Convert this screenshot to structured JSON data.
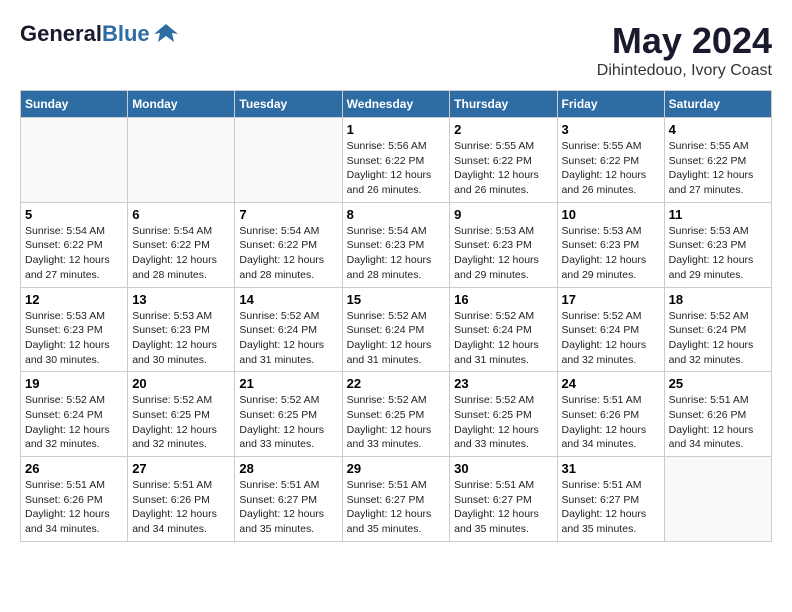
{
  "header": {
    "logo_general": "General",
    "logo_blue": "Blue",
    "month_year": "May 2024",
    "location": "Dihintedouo, Ivory Coast"
  },
  "weekdays": [
    "Sunday",
    "Monday",
    "Tuesday",
    "Wednesday",
    "Thursday",
    "Friday",
    "Saturday"
  ],
  "weeks": [
    [
      {
        "day": "",
        "info": ""
      },
      {
        "day": "",
        "info": ""
      },
      {
        "day": "",
        "info": ""
      },
      {
        "day": "1",
        "info": "Sunrise: 5:56 AM\nSunset: 6:22 PM\nDaylight: 12 hours\nand 26 minutes."
      },
      {
        "day": "2",
        "info": "Sunrise: 5:55 AM\nSunset: 6:22 PM\nDaylight: 12 hours\nand 26 minutes."
      },
      {
        "day": "3",
        "info": "Sunrise: 5:55 AM\nSunset: 6:22 PM\nDaylight: 12 hours\nand 26 minutes."
      },
      {
        "day": "4",
        "info": "Sunrise: 5:55 AM\nSunset: 6:22 PM\nDaylight: 12 hours\nand 27 minutes."
      }
    ],
    [
      {
        "day": "5",
        "info": "Sunrise: 5:54 AM\nSunset: 6:22 PM\nDaylight: 12 hours\nand 27 minutes."
      },
      {
        "day": "6",
        "info": "Sunrise: 5:54 AM\nSunset: 6:22 PM\nDaylight: 12 hours\nand 28 minutes."
      },
      {
        "day": "7",
        "info": "Sunrise: 5:54 AM\nSunset: 6:22 PM\nDaylight: 12 hours\nand 28 minutes."
      },
      {
        "day": "8",
        "info": "Sunrise: 5:54 AM\nSunset: 6:23 PM\nDaylight: 12 hours\nand 28 minutes."
      },
      {
        "day": "9",
        "info": "Sunrise: 5:53 AM\nSunset: 6:23 PM\nDaylight: 12 hours\nand 29 minutes."
      },
      {
        "day": "10",
        "info": "Sunrise: 5:53 AM\nSunset: 6:23 PM\nDaylight: 12 hours\nand 29 minutes."
      },
      {
        "day": "11",
        "info": "Sunrise: 5:53 AM\nSunset: 6:23 PM\nDaylight: 12 hours\nand 29 minutes."
      }
    ],
    [
      {
        "day": "12",
        "info": "Sunrise: 5:53 AM\nSunset: 6:23 PM\nDaylight: 12 hours\nand 30 minutes."
      },
      {
        "day": "13",
        "info": "Sunrise: 5:53 AM\nSunset: 6:23 PM\nDaylight: 12 hours\nand 30 minutes."
      },
      {
        "day": "14",
        "info": "Sunrise: 5:52 AM\nSunset: 6:24 PM\nDaylight: 12 hours\nand 31 minutes."
      },
      {
        "day": "15",
        "info": "Sunrise: 5:52 AM\nSunset: 6:24 PM\nDaylight: 12 hours\nand 31 minutes."
      },
      {
        "day": "16",
        "info": "Sunrise: 5:52 AM\nSunset: 6:24 PM\nDaylight: 12 hours\nand 31 minutes."
      },
      {
        "day": "17",
        "info": "Sunrise: 5:52 AM\nSunset: 6:24 PM\nDaylight: 12 hours\nand 32 minutes."
      },
      {
        "day": "18",
        "info": "Sunrise: 5:52 AM\nSunset: 6:24 PM\nDaylight: 12 hours\nand 32 minutes."
      }
    ],
    [
      {
        "day": "19",
        "info": "Sunrise: 5:52 AM\nSunset: 6:24 PM\nDaylight: 12 hours\nand 32 minutes."
      },
      {
        "day": "20",
        "info": "Sunrise: 5:52 AM\nSunset: 6:25 PM\nDaylight: 12 hours\nand 32 minutes."
      },
      {
        "day": "21",
        "info": "Sunrise: 5:52 AM\nSunset: 6:25 PM\nDaylight: 12 hours\nand 33 minutes."
      },
      {
        "day": "22",
        "info": "Sunrise: 5:52 AM\nSunset: 6:25 PM\nDaylight: 12 hours\nand 33 minutes."
      },
      {
        "day": "23",
        "info": "Sunrise: 5:52 AM\nSunset: 6:25 PM\nDaylight: 12 hours\nand 33 minutes."
      },
      {
        "day": "24",
        "info": "Sunrise: 5:51 AM\nSunset: 6:26 PM\nDaylight: 12 hours\nand 34 minutes."
      },
      {
        "day": "25",
        "info": "Sunrise: 5:51 AM\nSunset: 6:26 PM\nDaylight: 12 hours\nand 34 minutes."
      }
    ],
    [
      {
        "day": "26",
        "info": "Sunrise: 5:51 AM\nSunset: 6:26 PM\nDaylight: 12 hours\nand 34 minutes."
      },
      {
        "day": "27",
        "info": "Sunrise: 5:51 AM\nSunset: 6:26 PM\nDaylight: 12 hours\nand 34 minutes."
      },
      {
        "day": "28",
        "info": "Sunrise: 5:51 AM\nSunset: 6:27 PM\nDaylight: 12 hours\nand 35 minutes."
      },
      {
        "day": "29",
        "info": "Sunrise: 5:51 AM\nSunset: 6:27 PM\nDaylight: 12 hours\nand 35 minutes."
      },
      {
        "day": "30",
        "info": "Sunrise: 5:51 AM\nSunset: 6:27 PM\nDaylight: 12 hours\nand 35 minutes."
      },
      {
        "day": "31",
        "info": "Sunrise: 5:51 AM\nSunset: 6:27 PM\nDaylight: 12 hours\nand 35 minutes."
      },
      {
        "day": "",
        "info": ""
      }
    ]
  ]
}
